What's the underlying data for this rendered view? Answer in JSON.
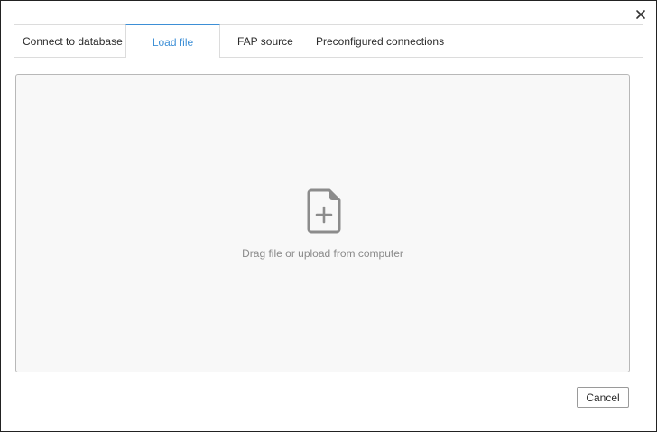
{
  "dialog": {
    "close_icon": "close-icon"
  },
  "tabs": [
    {
      "label": "Connect to database",
      "active": false
    },
    {
      "label": "Load file",
      "active": true
    },
    {
      "label": "FAP source",
      "active": false
    },
    {
      "label": "Preconfigured connections",
      "active": false
    }
  ],
  "dropzone": {
    "icon": "file-add-icon",
    "text": "Drag file or upload from computer"
  },
  "footer": {
    "cancel_label": "Cancel"
  },
  "colors": {
    "accent": "#3d8fd6",
    "icon_gray": "#8c8c8c",
    "dropzone_bg": "#f8f8f8"
  }
}
